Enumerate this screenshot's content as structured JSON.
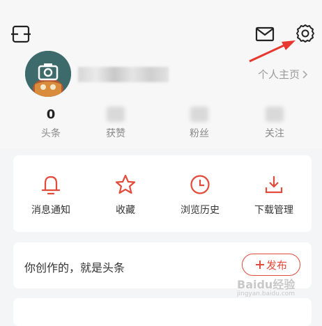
{
  "header": {
    "icons": [
      "scan-icon",
      "mail-icon",
      "settings-gear-icon"
    ],
    "annotation_color": "#e8372f"
  },
  "profile": {
    "link_label": "个人主页",
    "stats": [
      {
        "value": "0",
        "label": "头条"
      },
      {
        "value": "",
        "label": "获赞"
      },
      {
        "value": "",
        "label": "粉丝"
      },
      {
        "value": "",
        "label": "关注"
      }
    ]
  },
  "actions": {
    "items": [
      {
        "label": "消息通知",
        "icon": "bell-icon"
      },
      {
        "label": "收藏",
        "icon": "star-icon"
      },
      {
        "label": "浏览历史",
        "icon": "clock-icon"
      },
      {
        "label": "下载管理",
        "icon": "download-icon"
      }
    ],
    "accent_color": "#e24a3b"
  },
  "creation": {
    "text": "你创作的，就是头条",
    "publish_label": "发布"
  },
  "watermark": {
    "main": "Baidu经验",
    "sub": "jingyan.baidu.com"
  }
}
